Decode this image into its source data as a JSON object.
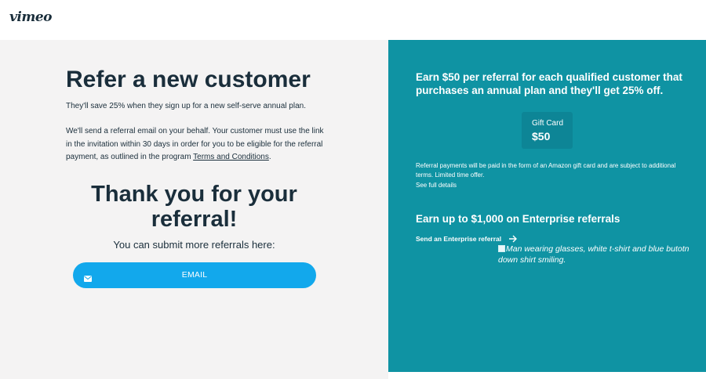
{
  "header": {
    "logo": "vimeo"
  },
  "main": {
    "title": "Refer a new customer",
    "intro": "They'll save 25% when they sign up for a new self-serve annual plan.",
    "body_text": "We'll send a referral email on your behalf. Your customer must use the link in the invitation within 30 days in order for you to be eligible for the referral payment, as outlined in the program ",
    "terms_link": "Terms and Conditions",
    "body_end": ".",
    "thanks": "Thank you for your referral!",
    "submit_more": "You can submit more referrals here:",
    "email_button": "EMAIL",
    "email_icon": "envelope-icon"
  },
  "aside": {
    "headline": "Earn $50 per referral for each qualified customer that purchases an annual plan and they'll get 25% off.",
    "gift_card_label": "Gift Card",
    "gift_card_value": "$50",
    "payment_note": "Referral payments will be paid in the form of an Amazon gift card and are subject to additional terms. Limited time offer.",
    "details_link": "See full details",
    "enterprise_title": "Earn up to $1,000 on Enterprise referrals",
    "enterprise_link": "Send an Enterprise referral",
    "enterprise_arrow_icon": "arrow-right-icon",
    "image_alt": "Man wearing glasses, white t-shirt and blue butotn down shirt smiling."
  },
  "colors": {
    "panel_teal": "#0f93a3",
    "gift_card_bg": "#0d8596",
    "email_button": "#12a8ec",
    "text_dark": "#1a2e3b",
    "left_bg": "#f4f3f3"
  }
}
